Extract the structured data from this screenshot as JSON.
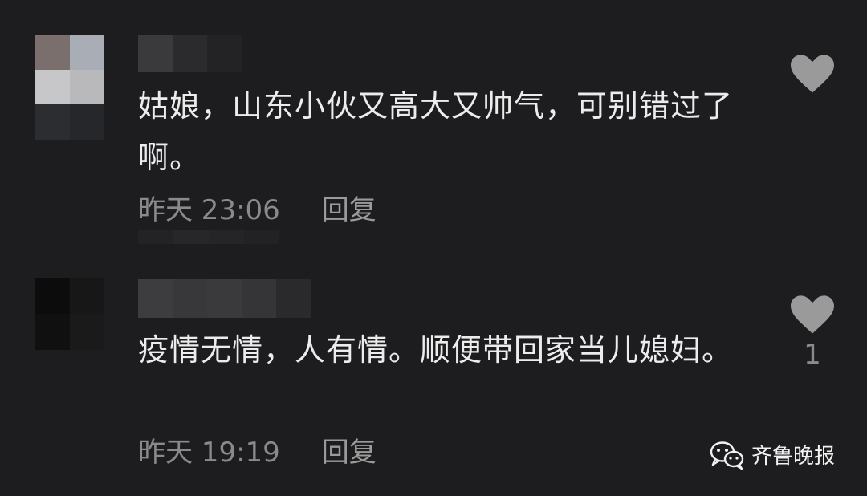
{
  "comments": [
    {
      "text": "姑娘，山东小伙又高大又帅气，可别错过了啊。",
      "time": "昨天 23:06",
      "reply_label": "回复",
      "likes": ""
    },
    {
      "text": "疫情无情，人有情。顺便带回家当儿媳妇。",
      "time": "昨天 19:19",
      "reply_label": "回复",
      "likes": "1"
    }
  ],
  "watermark": {
    "label": "齐鲁晚报",
    "icon": "wechat-icon"
  },
  "colors": {
    "background": "#1d1d1f",
    "text": "#ececec",
    "meta": "#8a8a8a",
    "heart": "#9a9a9a"
  }
}
